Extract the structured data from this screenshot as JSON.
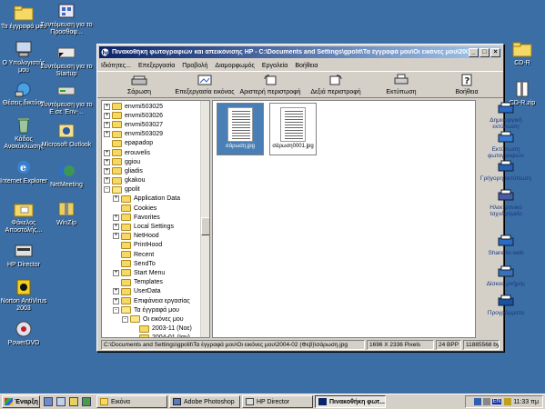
{
  "desktop": {
    "left_icons": [
      {
        "label": "Τα έγγραφά μου"
      },
      {
        "label": "Ο Υπολογιστής μου"
      },
      {
        "label": "Θέσεις δικτύου"
      },
      {
        "label": "Κάδος Ανακύκλωσης"
      },
      {
        "label": "Internet Explorer"
      },
      {
        "label": "Φάκελος Αποστολής..."
      },
      {
        "label": "HP Director"
      },
      {
        "label": "Norton AntiVirus 2003"
      },
      {
        "label": "PowerDVD"
      }
    ],
    "second_icons": [
      {
        "label": "Συντόμευση για το Προσθαφ..."
      },
      {
        "label": "Συντόμευση για το Startup"
      },
      {
        "label": "Συντόμευση για το E σε 'Env-..."
      },
      {
        "label": "Microsoft Outlook"
      },
      {
        "label": "NetMeeting"
      },
      {
        "label": "WinZip"
      }
    ],
    "right_icons": [
      {
        "label": "CD-R"
      },
      {
        "label": "CD-R.zip"
      }
    ]
  },
  "window": {
    "title": "Πινακοθήκη φωτογραφιών και απεικόνισης HP - C:\\Documents and Settings\\gpolit\\Τα έγγραφά μου\\Οι εικόνες μου\\200...",
    "menu": [
      "Ιδιότητες...",
      "Επεξεργασία",
      "Προβολή",
      "Διαμορφωμός",
      "Εργαλεία",
      "Βοήθεια"
    ],
    "toolbar": [
      "Σάρωση",
      "Επεξεργασία εικόνας",
      "Αριστερή περιστροφή",
      "Δεξιά περιστροφή",
      "Εκτύπωση",
      "Βοήθεια"
    ],
    "tree": [
      {
        "label": "envmi503025",
        "indent": 0,
        "toggle": "+"
      },
      {
        "label": "envmi503026",
        "indent": 0,
        "toggle": "+"
      },
      {
        "label": "envmi503027",
        "indent": 0,
        "toggle": "+"
      },
      {
        "label": "envmi503029",
        "indent": 0,
        "toggle": "+"
      },
      {
        "label": "epapadop",
        "indent": 0,
        "toggle": ""
      },
      {
        "label": "erouvelis",
        "indent": 0,
        "toggle": "+"
      },
      {
        "label": "ggiou",
        "indent": 0,
        "toggle": "+"
      },
      {
        "label": "gliadis",
        "indent": 0,
        "toggle": "+"
      },
      {
        "label": "gkakou",
        "indent": 0,
        "toggle": "+"
      },
      {
        "label": "gpolit",
        "indent": 0,
        "toggle": "-"
      },
      {
        "label": "Application Data",
        "indent": 1,
        "toggle": "+"
      },
      {
        "label": "Cookies",
        "indent": 1,
        "toggle": ""
      },
      {
        "label": "Favorites",
        "indent": 1,
        "toggle": "+"
      },
      {
        "label": "Local Settings",
        "indent": 1,
        "toggle": "+"
      },
      {
        "label": "NetHood",
        "indent": 1,
        "toggle": "+"
      },
      {
        "label": "PrintHood",
        "indent": 1,
        "toggle": ""
      },
      {
        "label": "Recent",
        "indent": 1,
        "toggle": ""
      },
      {
        "label": "SendTo",
        "indent": 1,
        "toggle": ""
      },
      {
        "label": "Start Menu",
        "indent": 1,
        "toggle": "+"
      },
      {
        "label": "Templates",
        "indent": 1,
        "toggle": ""
      },
      {
        "label": "UserData",
        "indent": 1,
        "toggle": "+"
      },
      {
        "label": "Επιφάνεια εργασίας",
        "indent": 1,
        "toggle": "+"
      },
      {
        "label": "Τα έγγραφά μου",
        "indent": 1,
        "toggle": "-"
      },
      {
        "label": "Οι εικόνες μου",
        "indent": 2,
        "toggle": "-"
      },
      {
        "label": "2003-11 (Νοε)",
        "indent": 3,
        "toggle": ""
      },
      {
        "label": "2004-01 (Ιαν)",
        "indent": 3,
        "toggle": ""
      },
      {
        "label": "2004-02 (Φεβ)",
        "indent": 3,
        "toggle": "",
        "selected": true
      }
    ],
    "thumbnails": [
      {
        "name": "σάρωση.jpg",
        "selected": true
      },
      {
        "name": "σάρωση0001.jpg",
        "selected": false
      }
    ],
    "actions": [
      "Δημιουργική εκτύπωση",
      "Εκτύπωση φωτογραφιών",
      "Γρήγορη εκτύπωση",
      "Ηλεκτρονικό ταχυδρομείο",
      "Share-to-web",
      "Δίσκος μνήμης",
      "Προγράμματα"
    ],
    "status": {
      "path": "C:\\Documents and Settings\\gpolit\\Τα έγγραφά μου\\Οι εικόνες μου\\2004-02 (Φεβ)\\σάρωση.jpg",
      "dimensions": "1696 X 2336 Pixels",
      "bpp": "24 BPP",
      "size": "11885568 bytes, M"
    }
  },
  "taskbar": {
    "start_label": "Έναρξη",
    "buttons": [
      {
        "label": "Εικόνα",
        "pressed": false
      },
      {
        "label": "Adobe Photoshop",
        "pressed": false
      },
      {
        "label": "HP Director",
        "pressed": false
      },
      {
        "label": "Πινακοθήκη φωτ...",
        "pressed": true
      }
    ],
    "lang": "EN",
    "clock": "11:33 πμ"
  },
  "colors": {
    "desktop": "#3b6ea5",
    "titlebar_start": "#0a246a",
    "titlebar_end": "#a6caf0",
    "chrome": "#d4d0c8",
    "selection": "#4a7fb5"
  }
}
